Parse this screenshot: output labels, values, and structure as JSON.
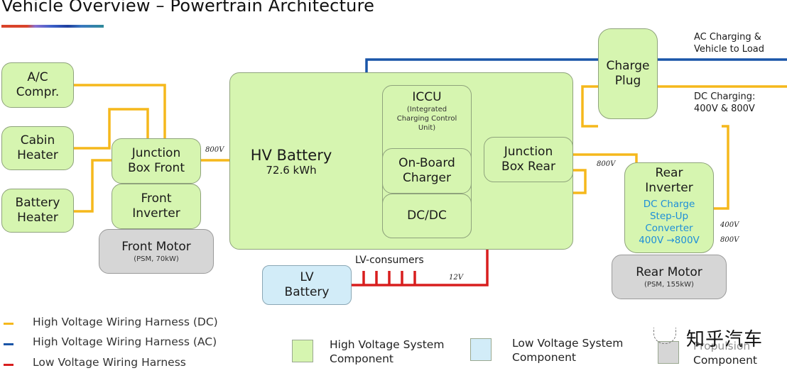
{
  "header": {
    "title": "Vehicle Overview – Powertrain Architecture"
  },
  "colors": {
    "hv_dc_wire": "#f5b81c",
    "hv_ac_wire": "#1a55a8",
    "lv_wire": "#d81e1e",
    "hv_component_fill": "#d6f5b0",
    "lv_component_fill": "#d2ecf8",
    "propulsion_fill": "#d6d6d6",
    "dc_step_up_text": "#1e8fd8"
  },
  "components": {
    "ac_compressor": [
      "A/C",
      "Compr."
    ],
    "cabin_heater": [
      "Cabin",
      "Heater"
    ],
    "battery_heater": [
      "Battery",
      "Heater"
    ],
    "junction_box_front": [
      "Junction",
      "Box Front"
    ],
    "front_inverter": [
      "Front",
      "Inverter"
    ],
    "front_motor": {
      "title": "Front Motor",
      "spec": "(PSM, 70kW)"
    },
    "hv_battery": {
      "title": "HV Battery",
      "capacity": "72.6 kWh"
    },
    "iccu": {
      "title": "ICCU",
      "desc": [
        "(Integrated",
        "Charging Control",
        "Unit)"
      ]
    },
    "on_board_charger": [
      "On-Board",
      "Charger"
    ],
    "dc_dc": "DC/DC",
    "junction_box_rear": [
      "Junction",
      "Box Rear"
    ],
    "charge_plug": [
      "Charge",
      "Plug"
    ],
    "rear_inverter": {
      "title": [
        "Rear",
        "Inverter"
      ],
      "converter": [
        "DC Charge",
        "Step-Up",
        "Converter",
        "400V →800V"
      ]
    },
    "rear_motor": {
      "title": "Rear Motor",
      "spec": "(PSM, 155kW)"
    },
    "lv_battery": [
      "LV",
      "Battery"
    ]
  },
  "annotations": {
    "ac_charging": [
      "AC Charging &",
      "Vehicle to Load"
    ],
    "dc_charging": [
      "DC Charging:",
      "400V & 800V"
    ],
    "front_voltage": "800V",
    "rear_voltage": "800V",
    "lv_consumers": "LV-consumers",
    "lv_voltage": "12V",
    "plug_voltage_400": "400V",
    "plug_voltage_800": "800V"
  },
  "legend": {
    "wires": [
      {
        "label": "High Voltage Wiring Harness (DC)",
        "color": "#f5b81c"
      },
      {
        "label": "High Voltage Wiring Harness (AC)",
        "color": "#1a55a8"
      },
      {
        "label": "Low Voltage Wiring Harness",
        "color": "#d81e1e"
      }
    ],
    "components": [
      {
        "label": [
          "High Voltage System",
          "Component"
        ],
        "color": "#d6f5b0"
      },
      {
        "label": [
          "Low Voltage System",
          "Component"
        ],
        "color": "#d2ecf8"
      },
      {
        "label": [
          "Propulsion",
          "Component"
        ],
        "color": "#d6d6d6"
      }
    ]
  },
  "watermark": "知乎汽车"
}
